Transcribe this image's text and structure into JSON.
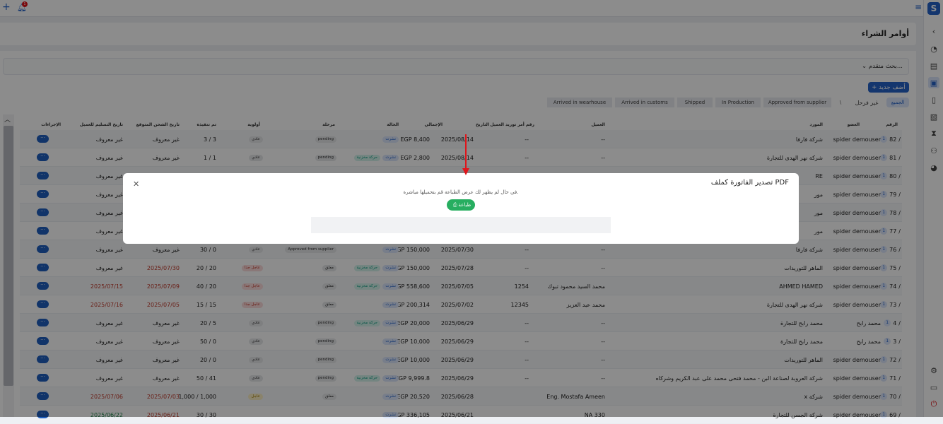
{
  "page": {
    "title": "أوامر الشراء"
  },
  "search": {
    "advanced_label": "بحث متقدم..."
  },
  "toolbar": {
    "add_label": "+ أضف جديد",
    "notif_count": "1"
  },
  "filters": {
    "all": "الجميع",
    "unsorted": "غير فرحل",
    "sep": "\\",
    "stages": [
      "Approved from supplier",
      "In Production",
      "Shipped",
      "Arrived in customs",
      "Arrived in wearhouse"
    ]
  },
  "table": {
    "headers": {
      "num": "الرقم",
      "member": "العضو",
      "supplier": "المورد",
      "client": "العميل",
      "client_po": "رقم أمر توريد العميل",
      "date": "التاريخ",
      "total": "الإجمالي",
      "status": "الحالة",
      "stage": "مرحلة",
      "priority": "أولوية",
      "fulfilled": "تم تنفيذه",
      "expected_ship": "تاريخ الشحن المتوقع",
      "delivery": "تاريخ التسليم للعميل",
      "actions": "الإجراءات"
    },
    "rows": [
      {
        "num": "82",
        "member": "spider demouser",
        "supplier": "شركة فارفا",
        "client": "--",
        "po": "--",
        "date": "2025/08/14",
        "total": "EGP 8,400",
        "status": "نشرت",
        "green": "",
        "stage": "pending",
        "priority": "عادي",
        "fulfilled": "3 / 3",
        "ship": "غير معروف",
        "delivery": "غير معروف"
      },
      {
        "num": "81",
        "member": "spider demouser",
        "supplier": "شركة نهر الهدى للتجارة",
        "client": "--",
        "po": "--",
        "date": "2025/08/14",
        "total": "EGP 2,800",
        "status": "نشرت",
        "green": "حركة مخزنية",
        "stage": "pending",
        "priority": "عادي",
        "fulfilled": "1 / 1",
        "ship": "غير معروف",
        "delivery": "غير معروف"
      },
      {
        "num": "80",
        "member": "spider demouser",
        "supplier": "RE",
        "client": "",
        "po": "",
        "date": "",
        "total": "",
        "status": "",
        "green": "",
        "stage": "",
        "priority": "",
        "fulfilled": "",
        "ship": "غير معروف",
        "delivery": "غير معروف"
      },
      {
        "num": "79",
        "member": "spider demouser",
        "supplier": "مور",
        "client": "",
        "po": "",
        "date": "",
        "total": "",
        "status": "",
        "green": "",
        "stage": "",
        "priority": "",
        "fulfilled": "",
        "ship": "غير معروف",
        "delivery": "غير معروف"
      },
      {
        "num": "78",
        "member": "spider demouser",
        "supplier": "مور",
        "client": "",
        "po": "",
        "date": "",
        "total": "",
        "status": "",
        "green": "",
        "stage": "",
        "priority": "",
        "fulfilled": "",
        "ship": "غير معروف",
        "delivery": "غير معروف"
      },
      {
        "num": "77",
        "member": "spider demouser",
        "supplier": "مور",
        "client": "",
        "po": "",
        "date": "",
        "total": "",
        "status": "",
        "green": "",
        "stage": "",
        "priority": "",
        "fulfilled": "",
        "ship": "غير معروف",
        "delivery": "غير معروف"
      },
      {
        "num": "76",
        "member": "spider demouser",
        "supplier": "شركة فارفا",
        "client": "--",
        "po": "--",
        "date": "2025/07/30",
        "total": "EGP 150,000",
        "status": "نشرت",
        "green": "",
        "stage": "Approved from supplier",
        "priority": "عادي",
        "fulfilled": "30 / 0",
        "ship": "غير معروف",
        "delivery": "غير معروف"
      },
      {
        "num": "75",
        "member": "spider demouser",
        "supplier": "الماهر للتوريدات",
        "client": "--",
        "po": "--",
        "date": "2025/07/28",
        "total": "EGP 150,000",
        "status": "نشرت",
        "green": "حركة مخزنية",
        "stage": "معلق",
        "priority": "عاجل جدا",
        "fulfilled": "20 / 20",
        "ship": "2025/07/30",
        "delivery": "غير معروف"
      },
      {
        "num": "74",
        "member": "spider demouser",
        "supplier": "AHMED HAMED",
        "client": "محمد السيد محمود تبوك",
        "po": "1254",
        "date": "2025/07/05",
        "total": "EGP 558,600",
        "status": "نشرت",
        "green": "حركة مخزنية",
        "stage": "معلق",
        "priority": "عاجل جدا",
        "fulfilled": "40 / 20",
        "ship": "2025/07/09",
        "delivery": "2025/07/15"
      },
      {
        "num": "73",
        "member": "spider demouser",
        "supplier": "شركة نهر الهدى للتجارة",
        "client": "محمد عبد العزيز",
        "po": "12345",
        "date": "2025/07/02",
        "total": "EGP 200,314",
        "status": "نشرت",
        "green": "",
        "stage": "معلق",
        "priority": "عاجل جدا",
        "fulfilled": "15 / 15",
        "ship": "2025/07/05",
        "delivery": "2025/07/16"
      },
      {
        "num": "4",
        "member": "محمد رابح",
        "supplier": "محمد رابح للتجارة",
        "client": "--",
        "po": "--",
        "date": "2025/06/29",
        "total": "EGP 20,000",
        "status": "نشرت",
        "green": "حركة مخزنية",
        "stage": "pending",
        "priority": "عادي",
        "fulfilled": "20 / 5",
        "ship": "غير معروف",
        "delivery": "غير معروف"
      },
      {
        "num": "3",
        "member": "محمد رابح",
        "supplier": "محمد رابح للتجارة",
        "client": "--",
        "po": "--",
        "date": "2025/06/29",
        "total": "EGP 10,000",
        "status": "نشرت",
        "green": "",
        "stage": "pending",
        "priority": "عادي",
        "fulfilled": "50 / 0",
        "ship": "غير معروف",
        "delivery": "غير معروف"
      },
      {
        "num": "72",
        "member": "spider demouser",
        "supplier": "الماهر للتوريدات",
        "client": "--",
        "po": "--",
        "date": "2025/06/29",
        "total": "EGP 10,000",
        "status": "نشرت",
        "green": "",
        "stage": "pending",
        "priority": "عادي",
        "fulfilled": "20 / 0",
        "ship": "غير معروف",
        "delivery": "غير معروف"
      },
      {
        "num": "71",
        "member": "spider demouser",
        "supplier": "شركة العروبة لصناعة البن - محمد فتحى محمد على عبد الكريم وشركاه",
        "client": "--",
        "po": "--",
        "date": "2025/06/29",
        "total": "EGP 9,999.8",
        "status": "نشرت",
        "green": "حركة مخزنية",
        "stage": "pending",
        "priority": "عادي",
        "fulfilled": "50 / 41",
        "ship": "غير معروف",
        "delivery": "غير معروف"
      },
      {
        "num": "70",
        "member": "spider demouser",
        "supplier": "x شركة",
        "client": "Eng. Mostafa Ameen",
        "po": "",
        "date": "2025/06/28",
        "total": "EGP 20,520",
        "status": "نشرت",
        "green": "",
        "stage": "معلق",
        "priority": "عاجل",
        "fulfilled": "1,000 / 1,000",
        "ship": "2025/07/03",
        "delivery": "2025/07/06"
      },
      {
        "num": "69",
        "member": "spider demouser",
        "supplier": "شركة الجسن للتجارة",
        "client": "NA 330",
        "po": "",
        "date": "2025/06/21",
        "total": "EGP 336,105",
        "status": "نشرت",
        "green": "",
        "stage": "",
        "priority": "",
        "fulfilled": "30 / 30",
        "ship": "2025/06/21",
        "delivery": "2025/06/22"
      }
    ]
  },
  "modal": {
    "title": "تصدير الفاتورة كملف PDF",
    "message": "في حال لم يظهر لك عرض الطباعة قم بتحميلها مباشرة.",
    "print_label": "طباعة",
    "print_icon": "⎙",
    "close": "✕"
  },
  "colors": {
    "accent": "#2563c9",
    "print": "#27ae60",
    "urgent": "#c0392b",
    "arrow": "#e0151b"
  }
}
